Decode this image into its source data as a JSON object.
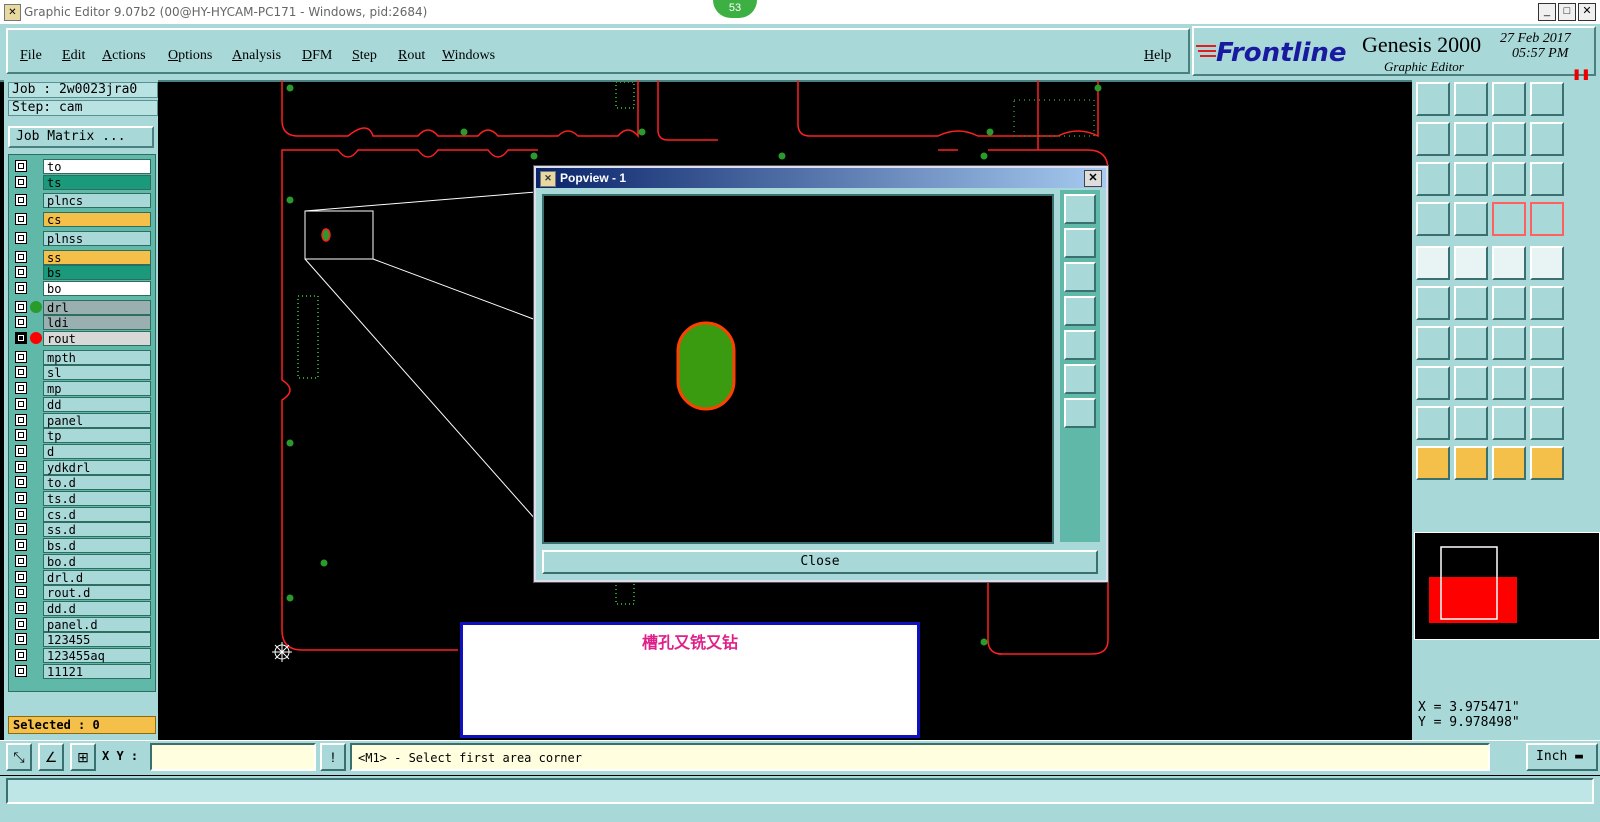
{
  "window": {
    "title": "Graphic Editor 9.07b2 (00@HY-HYCAM-PC171 - Windows, pid:2684)",
    "badge": "53",
    "app_icon": "x-icon",
    "ctrl_minimize": "_",
    "ctrl_restore": "□",
    "ctrl_close": "✕"
  },
  "menu": {
    "items": [
      "File",
      "Edit",
      "Actions",
      "Options",
      "Analysis",
      "DFM",
      "Step",
      "Rout",
      "Windows"
    ],
    "help": "Help"
  },
  "brand": {
    "logo": "Frontline",
    "product": "Genesis 2000",
    "subtitle": "Graphic Editor",
    "date": "27 Feb 2017",
    "time": "05:57 PM",
    "pause": "❚❚"
  },
  "job": {
    "job_line": "Job : 2w0023jra0",
    "step_line": "Step: cam",
    "matrix_button": "Job Matrix ..."
  },
  "layers": [
    {
      "name": "to",
      "color": "#ffffff",
      "dot": ""
    },
    {
      "name": "ts",
      "color": "#1a9a7a",
      "dot": ""
    },
    {
      "name": "plncs",
      "color": "#a8d8d8",
      "dot": ""
    },
    {
      "name": "cs",
      "color": "#f5c04a",
      "dot": ""
    },
    {
      "name": "plnss",
      "color": "#a8d8d8",
      "dot": ""
    },
    {
      "name": "ss",
      "color": "#f5c04a",
      "dot": ""
    },
    {
      "name": "bs",
      "color": "#1a9a7a",
      "dot": ""
    },
    {
      "name": "bo",
      "color": "#ffffff",
      "dot": ""
    },
    {
      "name": "drl",
      "color": "#9ab0b0",
      "dot": "#2a9a2a"
    },
    {
      "name": "ldi",
      "color": "#9ab0b0",
      "dot": ""
    },
    {
      "name": "rout",
      "color": "#d8d8d8",
      "dot": "#ff0000",
      "selected": true
    },
    {
      "name": "mpth",
      "color": "#a8d8d8",
      "dot": ""
    },
    {
      "name": "sl",
      "color": "#a8d8d8",
      "dot": ""
    },
    {
      "name": "mp",
      "color": "#a8d8d8",
      "dot": ""
    },
    {
      "name": "dd",
      "color": "#a8d8d8",
      "dot": ""
    },
    {
      "name": "panel",
      "color": "#a8d8d8",
      "dot": ""
    },
    {
      "name": "tp",
      "color": "#a8d8d8",
      "dot": ""
    },
    {
      "name": "d",
      "color": "#a8d8d8",
      "dot": ""
    },
    {
      "name": "ydkdrl",
      "color": "#a8d8d8",
      "dot": ""
    },
    {
      "name": "to.d",
      "color": "#a8d8d8",
      "dot": ""
    },
    {
      "name": "ts.d",
      "color": "#a8d8d8",
      "dot": ""
    },
    {
      "name": "cs.d",
      "color": "#a8d8d8",
      "dot": ""
    },
    {
      "name": "ss.d",
      "color": "#a8d8d8",
      "dot": ""
    },
    {
      "name": "bs.d",
      "color": "#a8d8d8",
      "dot": ""
    },
    {
      "name": "bo.d",
      "color": "#a8d8d8",
      "dot": ""
    },
    {
      "name": "drl.d",
      "color": "#a8d8d8",
      "dot": ""
    },
    {
      "name": "rout.d",
      "color": "#a8d8d8",
      "dot": ""
    },
    {
      "name": "dd.d",
      "color": "#a8d8d8",
      "dot": ""
    },
    {
      "name": "panel.d",
      "color": "#a8d8d8",
      "dot": ""
    },
    {
      "name": "123455",
      "color": "#a8d8d8",
      "dot": ""
    },
    {
      "name": "123455aq",
      "color": "#a8d8d8",
      "dot": ""
    },
    {
      "name": "11121",
      "color": "#a8d8d8",
      "dot": ""
    }
  ],
  "selected": "Selected : 0",
  "coords": {
    "x": "X = 3.975471\"",
    "y": "Y = 9.978498\""
  },
  "status": {
    "xy_label": "X Y :",
    "xy_value": "",
    "alert_icon": "!",
    "message": "<M1> - Select first area corner",
    "units": "Inch",
    "units_arrow": "▬"
  },
  "popview": {
    "title": "Popview - 1",
    "close_label": "Close",
    "close_x": "✕",
    "icon": "x-icon"
  },
  "note": {
    "text": "槽孔又铣又钻"
  },
  "colors": {
    "panel": "#a8d8d8",
    "rout": "#ff0000",
    "pad": "#2a9a2a",
    "note_text": "#e0208a"
  }
}
